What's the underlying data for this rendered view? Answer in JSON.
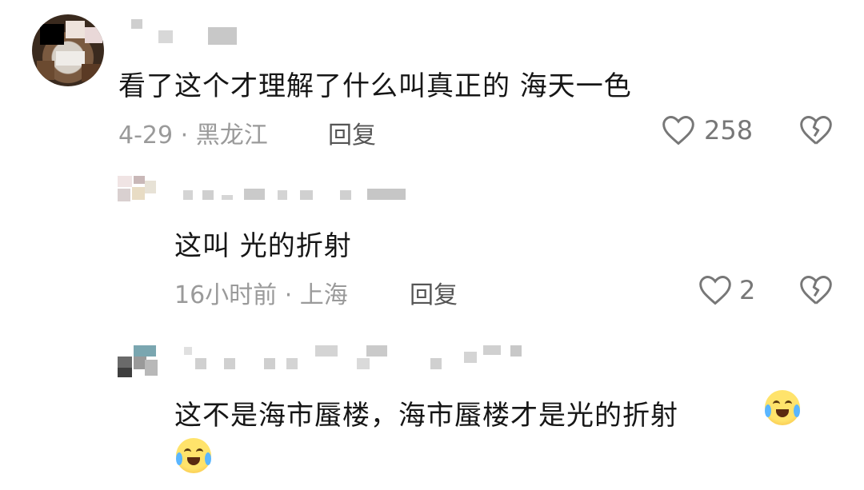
{
  "comments": [
    {
      "text": "看了这个才理解了什么叫真正的 海天一色",
      "meta": "4-29 · 黑龙江",
      "reply_label": "回复",
      "likes": "258",
      "replies": [
        {
          "text": "这叫 光的折射",
          "meta": "16小时前 · 上海",
          "reply_label": "回复",
          "likes": "2"
        },
        {
          "text": "这不是海市蜃楼，海市蜃楼才是光的折射"
        }
      ]
    }
  ],
  "icons": {
    "like": "heart-outline-icon",
    "dislike": "broken-heart-icon",
    "emoji": "crying-laughing-emoji"
  },
  "colors": {
    "text": "#161616",
    "meta": "#9a9a9a",
    "icon": "#777777"
  }
}
